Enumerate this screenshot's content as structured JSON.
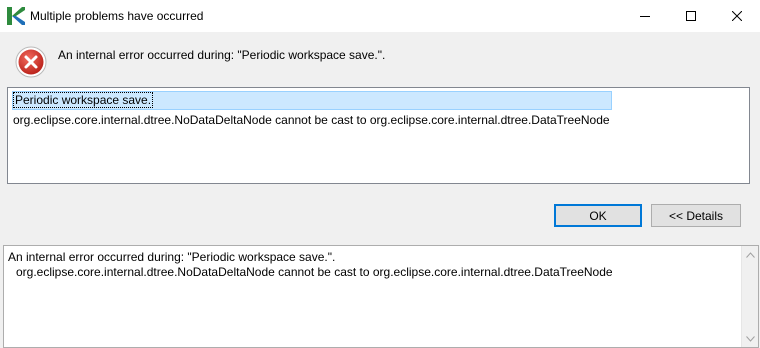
{
  "window": {
    "title": "Multiple problems have occurred",
    "app_icon": "kepler-app-icon",
    "controls": {
      "minimize": "minimize-icon",
      "maximize": "maximize-icon",
      "close": "close-icon"
    }
  },
  "header": {
    "icon": "error-icon",
    "message": "An internal error occurred during: \"Periodic workspace save.\"."
  },
  "details_list": {
    "items": [
      "Periodic workspace save.",
      "org.eclipse.core.internal.dtree.NoDataDeltaNode cannot be cast to org.eclipse.core.internal.dtree.DataTreeNode"
    ],
    "selected_index": 0
  },
  "buttons": {
    "ok_label": "OK",
    "details_label": "<< Details"
  },
  "details_text": {
    "lines": [
      "An internal error occurred during: \"Periodic workspace save.\".",
      "org.eclipse.core.internal.dtree.NoDataDeltaNode cannot be cast to org.eclipse.core.internal.dtree.DataTreeNode"
    ]
  },
  "colors": {
    "error_red": "#d9312b",
    "selection_bg": "#cce8ff",
    "app_icon_green": "#2e8b3e",
    "app_icon_blue": "#1e6fb8"
  }
}
